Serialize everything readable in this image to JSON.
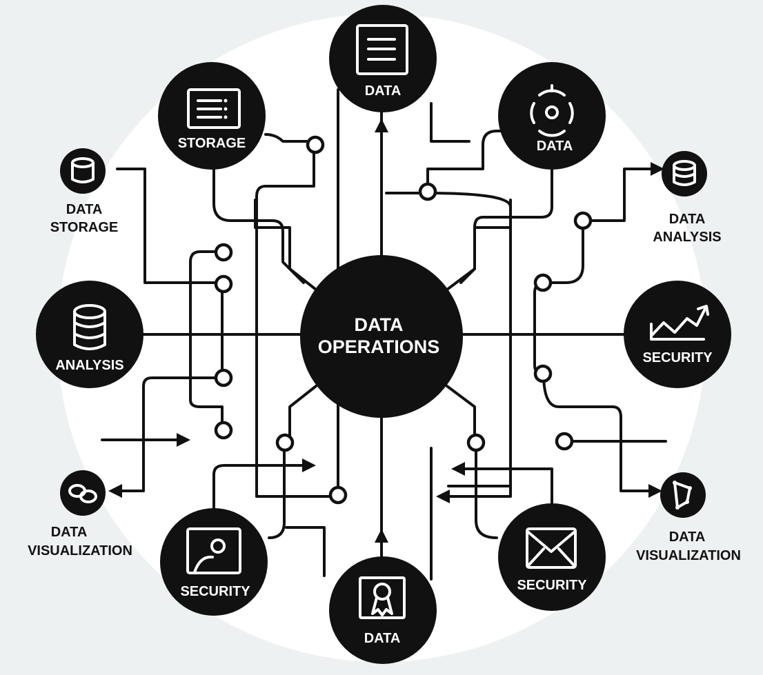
{
  "hub": {
    "line1": "DATA",
    "line2": "OPERATIONS"
  },
  "nodes": {
    "top": "DATA",
    "top_left": "STORAGE",
    "top_right": "DATA",
    "left": "ANALYSIS",
    "right": "SECURITY",
    "bottom_left": "SECURITY",
    "bottom": "DATA",
    "bottom_right": "SECURITY"
  },
  "side_labels": {
    "data_storage": [
      "DATA",
      "STORAGE"
    ],
    "data_analysis": [
      "DATA",
      "ANALYSIS"
    ],
    "data_visualization_left": [
      "DATA",
      "VISUALIZATION"
    ],
    "data_visualization_right": [
      "DATA",
      "VISUALIZATION"
    ]
  },
  "colors": {
    "background": "#eef1f2",
    "halo": "#ffffff",
    "ink": "#111111",
    "node_text": "#ffffff"
  },
  "icons": {
    "top": "document-icon",
    "top_left": "list-panel-icon",
    "top_right": "target-gear-icon",
    "left": "database-icon",
    "right": "trend-chart-icon",
    "bottom_left": "user-profile-icon",
    "bottom": "certificate-icon",
    "bottom_right": "envelope-icon",
    "data_storage": "cylinder-icon",
    "data_analysis": "database-stack-icon",
    "data_visualization_left": "link-rings-icon",
    "data_visualization_right": "graph-nodes-icon"
  }
}
